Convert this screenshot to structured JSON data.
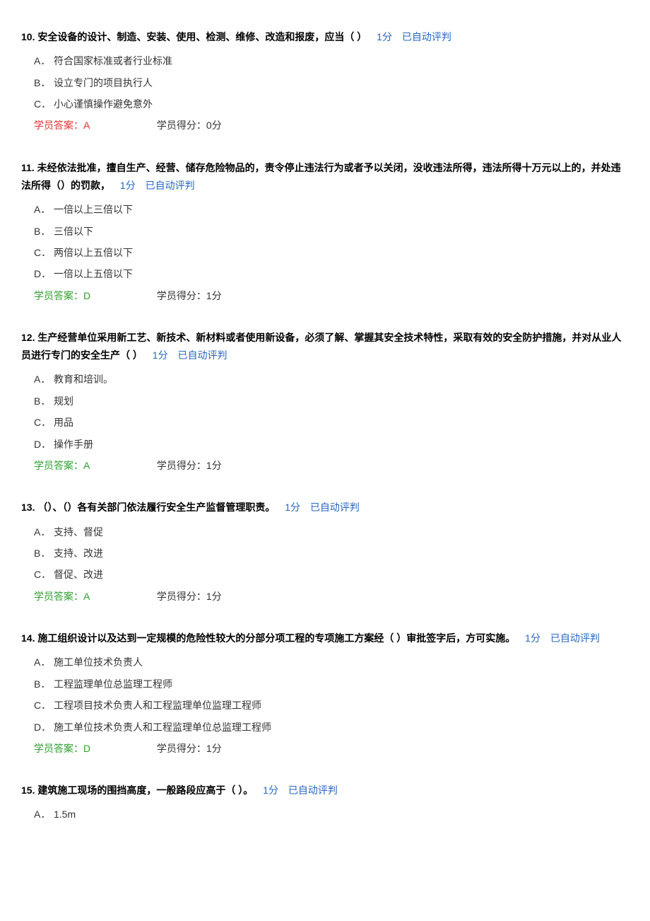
{
  "labels": {
    "score_suffix": "分",
    "auto_judge": "已自动评判",
    "student_answer_prefix": "学员答案：",
    "student_score_prefix": "学员得分：",
    "student_score_suffix": "分"
  },
  "questions": [
    {
      "num": "10.",
      "text": "安全设备的设计、制造、安装、使用、检测、维修、改造和报废，应当（ ）",
      "score": "1",
      "options": [
        {
          "label": "A．",
          "text": "符合国家标准或者行业标准"
        },
        {
          "label": "B．",
          "text": "设立专门的项目执行人"
        },
        {
          "label": "C．",
          "text": "小心谨慎操作避免意外"
        }
      ],
      "answer": "A",
      "answer_correct": false,
      "earned": "0"
    },
    {
      "num": "11.",
      "text": "未经依法批准，擅自生产、经营、储存危险物品的，责令停止违法行为或者予以关闭，没收违法所得，违法所得十万元以上的，并处违法所得（）的罚款，",
      "score": "1",
      "options": [
        {
          "label": "A．",
          "text": "一倍以上三倍以下"
        },
        {
          "label": "B．",
          "text": "三倍以下"
        },
        {
          "label": "C．",
          "text": "两倍以上五倍以下"
        },
        {
          "label": "D．",
          "text": "一倍以上五倍以下"
        }
      ],
      "answer": "D",
      "answer_correct": true,
      "earned": "1"
    },
    {
      "num": "12.",
      "text": "生产经营单位采用新工艺、新技术、新材料或者使用新设备，必须了解、掌握其安全技术特性，采取有效的安全防护措施，并对从业人员进行专门的安全生产（ ）",
      "score": "1",
      "options": [
        {
          "label": "A．",
          "text": "教育和培训。"
        },
        {
          "label": "B．",
          "text": "规划"
        },
        {
          "label": "C．",
          "text": "用品"
        },
        {
          "label": "D．",
          "text": "操作手册"
        }
      ],
      "answer": "A",
      "answer_correct": true,
      "earned": "1"
    },
    {
      "num": "13.",
      "text": "（）、（）各有关部门依法履行安全生产监督管理职责。",
      "score": "1",
      "options": [
        {
          "label": "A．",
          "text": "支持、督促"
        },
        {
          "label": "B．",
          "text": "支持、改进"
        },
        {
          "label": "C．",
          "text": "督促、改进"
        }
      ],
      "answer": "A",
      "answer_correct": true,
      "earned": "1"
    },
    {
      "num": "14.",
      "text": "施工组织设计以及达到一定规模的危险性较大的分部分项工程的专项施工方案经（  ）审批签字后，方可实施。",
      "score": "1",
      "options": [
        {
          "label": "A．",
          "text": "施工单位技术负责人"
        },
        {
          "label": "B．",
          "text": "工程监理单位总监理工程师"
        },
        {
          "label": "C．",
          "text": "工程项目技术负责人和工程监理单位监理工程师"
        },
        {
          "label": "D．",
          "text": "施工单位技术负责人和工程监理单位总监理工程师"
        }
      ],
      "answer": "D",
      "answer_correct": true,
      "earned": "1"
    },
    {
      "num": "15.",
      "text": "建筑施工现场的围挡高度，一般路段应高于（ ）。",
      "score": "1",
      "options": [
        {
          "label": "A．",
          "text": "1.5m"
        }
      ],
      "answer": "",
      "answer_correct": null,
      "earned": ""
    }
  ]
}
